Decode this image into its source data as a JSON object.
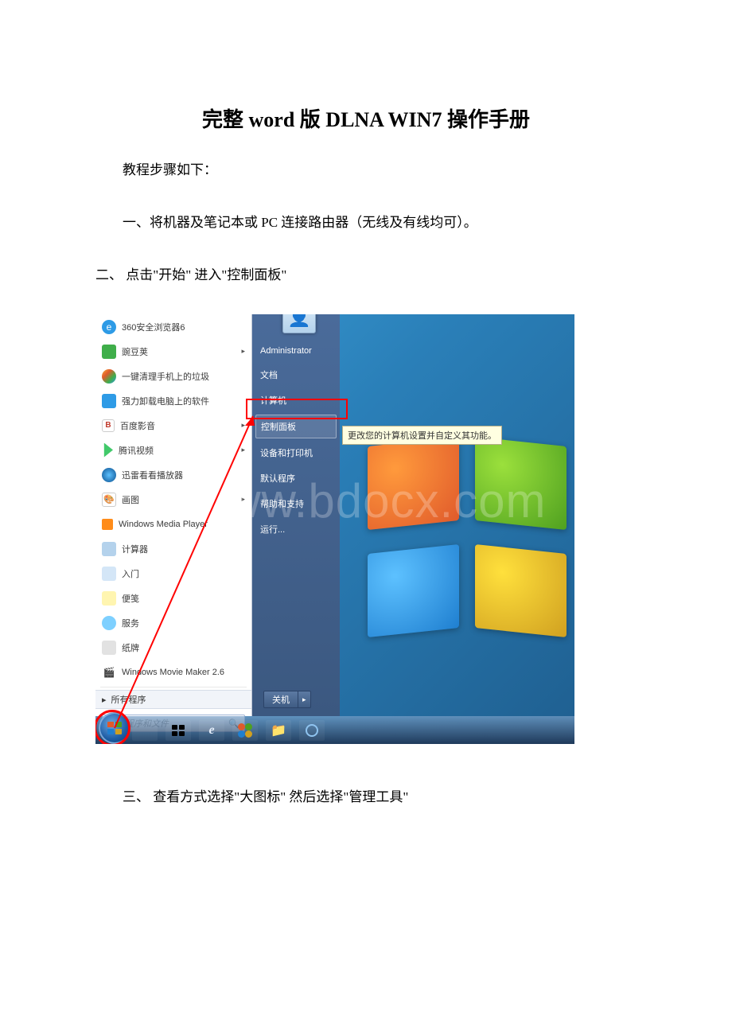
{
  "doc": {
    "title": "完整 word 版 DLNA WIN7 操作手册",
    "intro": "教程步骤如下：",
    "step1": "一、将机器及笔记本或 PC 连接路由器（无线及有线均可）。",
    "step2": "二、 点击\"开始\" 进入\"控制面板\"",
    "step3": "三、 查看方式选择\"大图标\" 然后选择\"管理工具\""
  },
  "watermark": "www.bdocx.com",
  "start_menu": {
    "left_items": [
      "360安全浏览器6",
      "豌豆荚",
      "一键清理手机上的垃圾",
      "强力卸载电脑上的软件",
      "百度影音",
      "腾讯视频",
      "迅雷看看播放器",
      "画图",
      "Windows Media Player",
      "计算器",
      "入门",
      "便笺",
      "服务",
      "纸牌",
      "Windows Movie Maker 2.6"
    ],
    "all_programs": "所有程序",
    "search_placeholder": "搜索程序和文件",
    "user": "Administrator",
    "right_items": [
      "文档",
      "计算机",
      "控制面板",
      "设备和打印机",
      "默认程序",
      "帮助和支持",
      "运行..."
    ],
    "tooltip": "更改您的计算机设置并自定义其功能。",
    "shutdown": "关机"
  }
}
